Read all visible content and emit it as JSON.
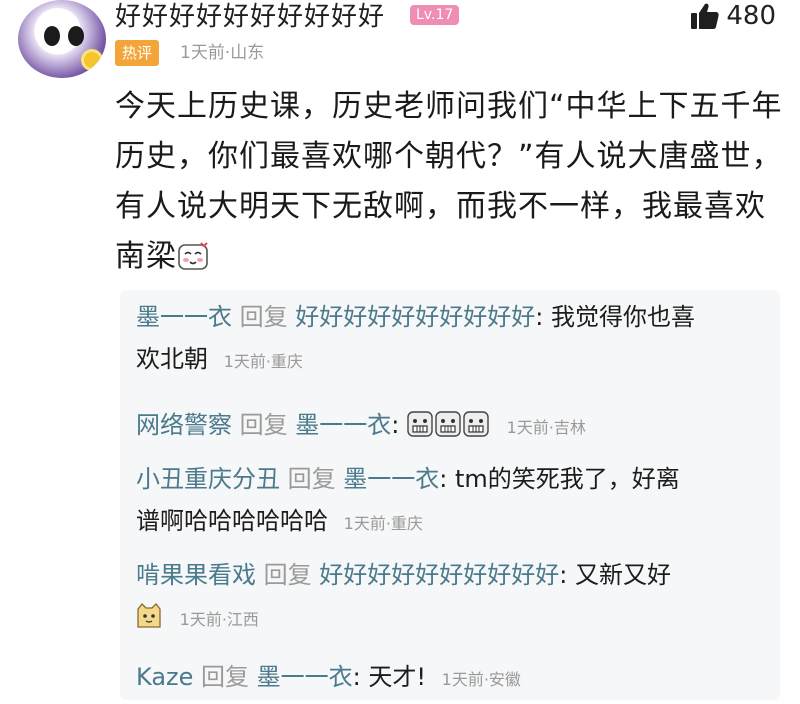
{
  "comment": {
    "username": "好好好好好好好好好好",
    "level": "Lv.17",
    "hot_badge": "热评",
    "time": "1天前",
    "location": "山东",
    "likes": "480",
    "text_lines": [
      "今天上历史课，历史老师问我们“中华上下五千年",
      "历史，你们最喜欢哪个朝代？”有人说大唐盛世，",
      "有人说大明天下无敌啊，而我不一样，我最喜欢",
      "南梁"
    ]
  },
  "replies": [
    {
      "name": "墨一一衣",
      "action": "回复",
      "target": "好好好好好好好好好好",
      "text_lines": [
        ": 我觉得你也喜",
        "欢北朝"
      ],
      "time": "1天前·重庆"
    },
    {
      "name": "网络警察",
      "action": "回复",
      "target": "墨一一衣",
      "text": ":",
      "time": "1天前·吉林",
      "emoji_count": 3
    },
    {
      "name": "小丑重庆分丑",
      "action": "回复",
      "target": "墨一一衣",
      "text_lines": [
        ": tm的笑死我了，好离",
        "谱啊哈哈哈哈哈哈"
      ],
      "time": "1天前·重庆"
    },
    {
      "name": "啃果果看戏",
      "action": "回复",
      "target": "好好好好好好好好好好",
      "text": ": 又新又好",
      "time": "1天前·江西"
    },
    {
      "name": "Kaze",
      "action": "回复",
      "target": "墨一一衣",
      "text": ": 天才!",
      "time": "1天前·安徽"
    }
  ],
  "colors": {
    "name": "#4a7a8c",
    "meta": "#9a9a9a",
    "hot_badge": "#f4a53a",
    "level_badge": "#f08db4",
    "reply_bg": "#f6f7f8"
  },
  "icons": [
    "thumbs-up-icon",
    "grimace-face-icon",
    "cat-face-icon",
    "blush-face-icon"
  ]
}
